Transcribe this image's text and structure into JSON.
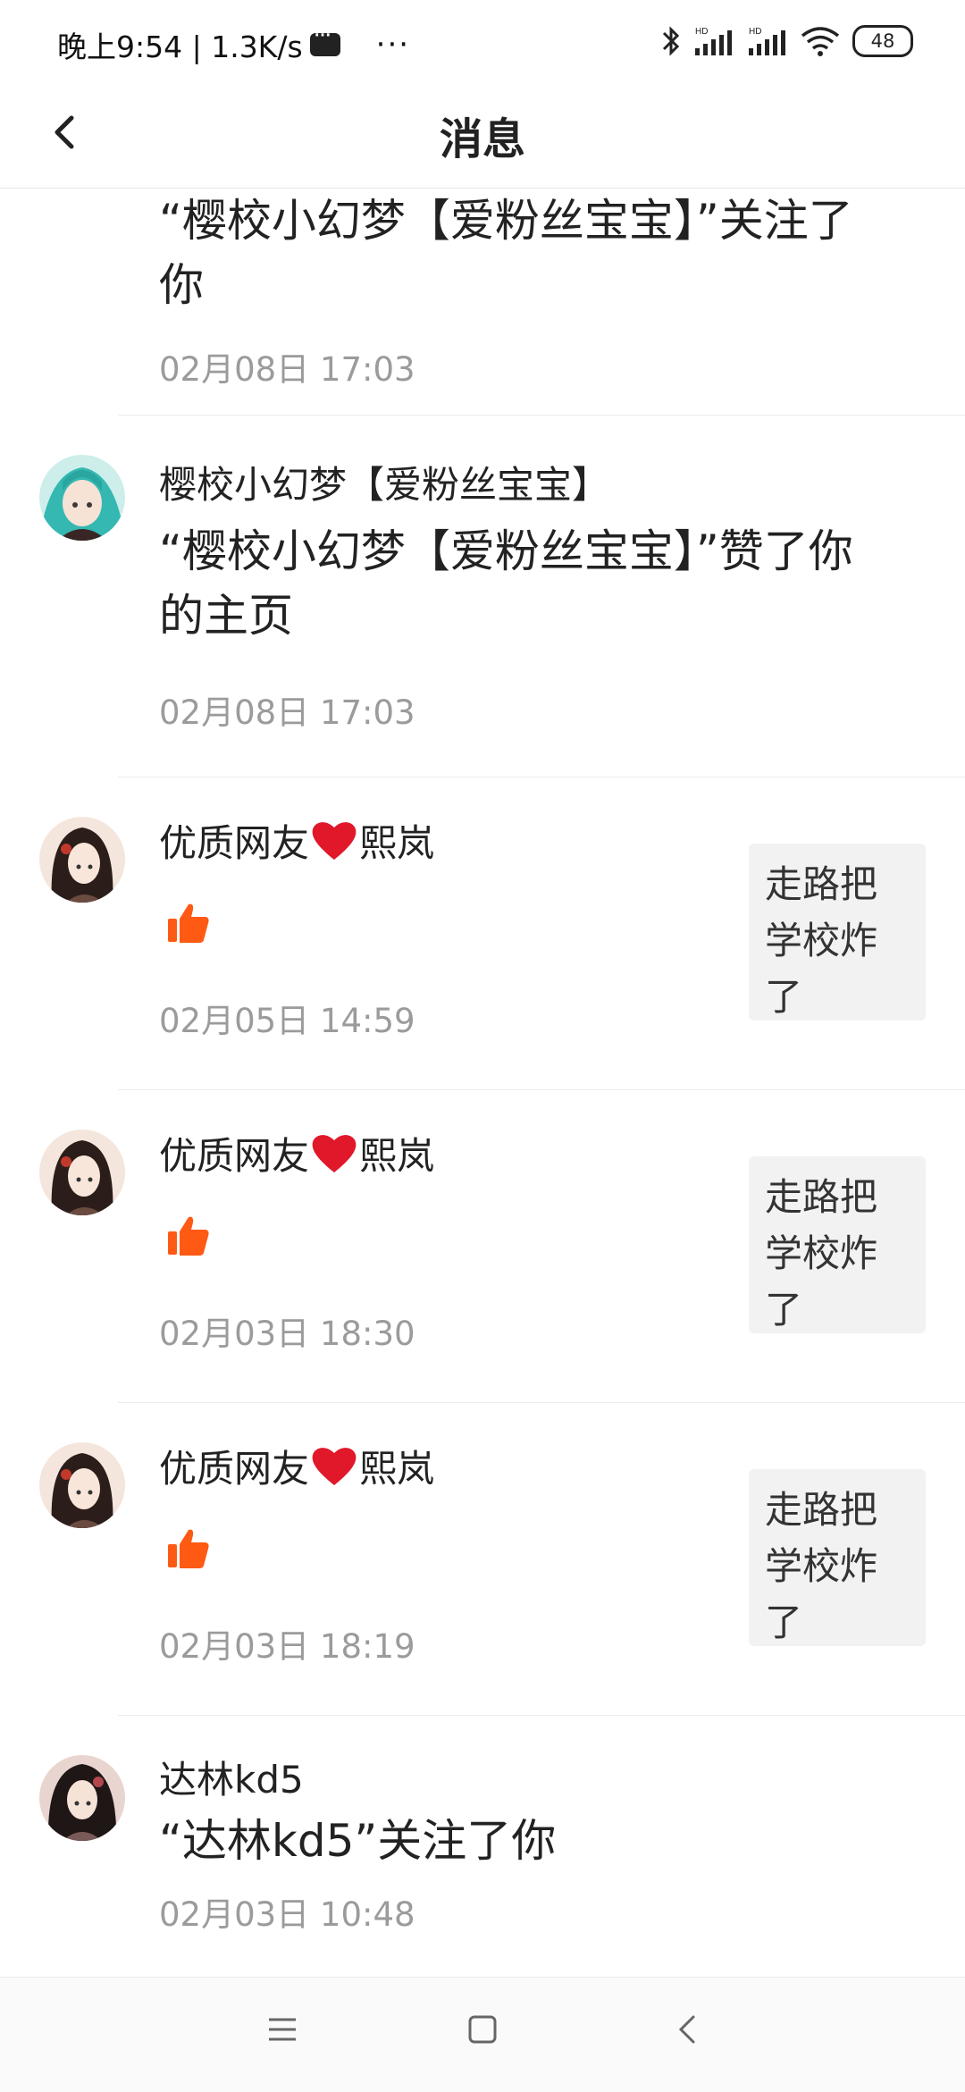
{
  "status_bar": {
    "time_net": "晚上9:54 | 1.3K/s",
    "more": "···",
    "bt": "BT",
    "hd1": "HD",
    "hd2": "HD",
    "battery": "48"
  },
  "header": {
    "title": "消息"
  },
  "notifications": [
    {
      "type": "follow",
      "content": "“樱校小幻梦【爱粉丝宝宝】”关注了你",
      "time": "02月08日 17:03"
    },
    {
      "type": "like_profile",
      "username": "樱校小幻梦【爱粉丝宝宝】",
      "content": "“樱校小幻梦【爱粉丝宝宝】”赞了你的主页",
      "time": "02月08日 17:03",
      "avatar_colors": [
        "#8fd9d3",
        "#2bb5b0"
      ]
    },
    {
      "type": "like_post",
      "username_a": "优质网友",
      "username_b": "熙岚",
      "time": "02月05日 14:59",
      "preview": "走路把学校炸了"
    },
    {
      "type": "like_post",
      "username_a": "优质网友",
      "username_b": "熙岚",
      "time": "02月03日 18:30",
      "preview": "走路把学校炸了"
    },
    {
      "type": "like_post",
      "username_a": "优质网友",
      "username_b": "熙岚",
      "time": "02月03日 18:19",
      "preview": "走路把学校炸了"
    },
    {
      "type": "follow",
      "username": "达林kd5",
      "content": "“达林kd5”关注了你",
      "time": "02月03日 10:48"
    }
  ],
  "colors": {
    "like_orange": "#ff5a14",
    "heart_red": "#e0182a",
    "time_gray": "#9b9b9b"
  },
  "system_nav": {
    "menu_icon": "menu-icon",
    "home_icon": "home-icon",
    "back_icon": "back-icon"
  }
}
